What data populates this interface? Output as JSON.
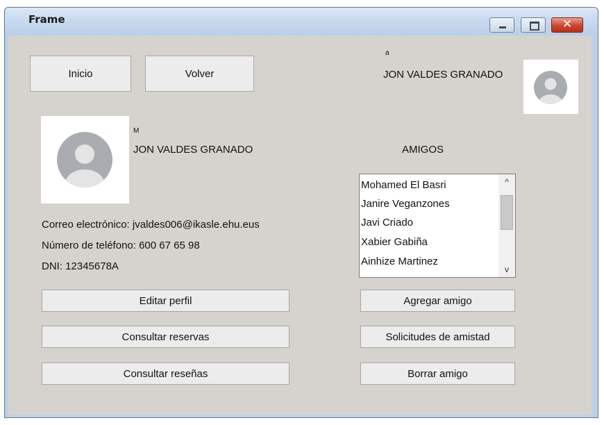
{
  "window": {
    "title": "Frame",
    "close_glyph": "✕"
  },
  "nav": {
    "home_label": "Inicio",
    "back_label": "Volver"
  },
  "header_user": {
    "tag": "a",
    "name": "JON VALDES GRANADO"
  },
  "profile": {
    "tag": "M",
    "name": "JON VALDES GRANADO",
    "email_line": "Correo electrónico: jvaldes006@ikasle.ehu.eus",
    "phone_line": "Número de teléfono: 600 67 65 98",
    "dni_line": "DNI: 12345678A"
  },
  "friends": {
    "heading": "AMIGOS",
    "items": [
      "Mohamed El Basri",
      "Janire Veganzones",
      "Javi Criado",
      "Xabier Gabiña",
      "Ainhize Martinez"
    ],
    "scroll_up": "^",
    "scroll_down": "v"
  },
  "actions": {
    "edit_profile": "Editar perfil",
    "view_bookings": "Consultar reservas",
    "view_reviews": "Consultar reseñas",
    "add_friend": "Agregar amigo",
    "friend_requests": "Solicitudes de amistad",
    "remove_friend": "Borrar amigo"
  },
  "colors": {
    "panel": "#d6d3ce",
    "button": "#ececec",
    "titlebar": "#c8daef",
    "close": "#c9452f"
  },
  "icons": [
    "minimize-icon",
    "maximize-icon",
    "close-icon",
    "user-avatar-icon",
    "scroll-up-icon",
    "scroll-down-icon"
  ]
}
